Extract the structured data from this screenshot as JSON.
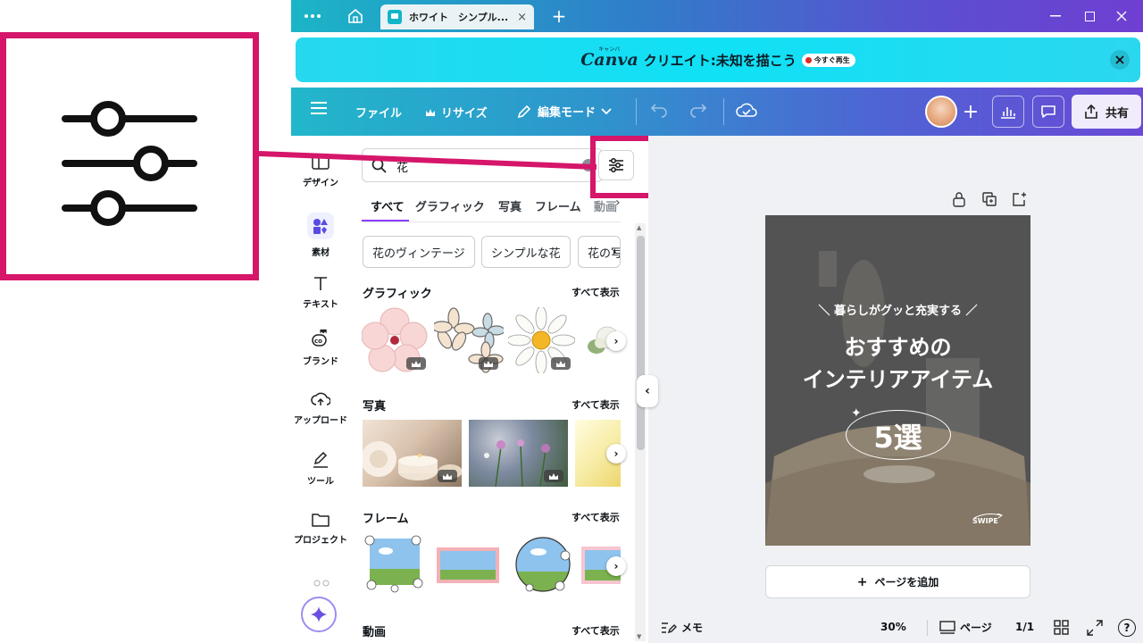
{
  "titlebar": {
    "menu_icon": "more-horizontal-icon",
    "home_icon": "home-icon",
    "tab_title": "ホワイト　シンプル...",
    "new_tab": "+",
    "window_controls": [
      "minimize",
      "maximize",
      "close"
    ]
  },
  "banner": {
    "logo": "Canva",
    "logo_small": "キャンバ",
    "text": "クリエイト:未知を描こう",
    "pill": "今すぐ再生"
  },
  "toolbar": {
    "file": "ファイル",
    "resize": "リサイズ",
    "edit_mode": "編集モード",
    "share": "共有"
  },
  "rail": [
    {
      "label": "デザイン",
      "icon": "layout-icon"
    },
    {
      "label": "素材",
      "icon": "elements-icon"
    },
    {
      "label": "テキスト",
      "icon": "text-icon"
    },
    {
      "label": "ブランド",
      "icon": "brand-icon"
    },
    {
      "label": "アップロード",
      "icon": "upload-cloud-icon"
    },
    {
      "label": "ツール",
      "icon": "pen-tool-icon"
    },
    {
      "label": "プロジェクト",
      "icon": "folder-icon"
    }
  ],
  "search": {
    "value": "花"
  },
  "tabs": [
    "すべて",
    "グラフィック",
    "写真",
    "フレーム",
    "動画"
  ],
  "chips": [
    "花のヴィンテージ",
    "シンプルな花",
    "花の写"
  ],
  "sections": {
    "graphics": {
      "title": "グラフィック",
      "see_all": "すべて表示"
    },
    "photos": {
      "title": "写真",
      "see_all": "すべて表示"
    },
    "frames": {
      "title": "フレーム",
      "see_all": "すべて表示"
    },
    "videos": {
      "title": "動画",
      "see_all": "すべて表示"
    }
  },
  "design": {
    "kicker": "＼ 暮らしがグッと充実する ／",
    "line1": "おすすめの",
    "line2": "インテリアアイテム",
    "badge": "5選",
    "swipe": "SWIPE"
  },
  "add_page": "ページを追加",
  "status": {
    "notes": "メモ",
    "zoom": "30%",
    "pages_label": "ページ",
    "page_count": "1/1"
  },
  "colors": {
    "highlight": "#d5166a",
    "toolbar_start": "#22b7cb",
    "toolbar_end": "#6a49d6",
    "banner": "#10e1f5",
    "active_tab": "#8b3dff"
  }
}
